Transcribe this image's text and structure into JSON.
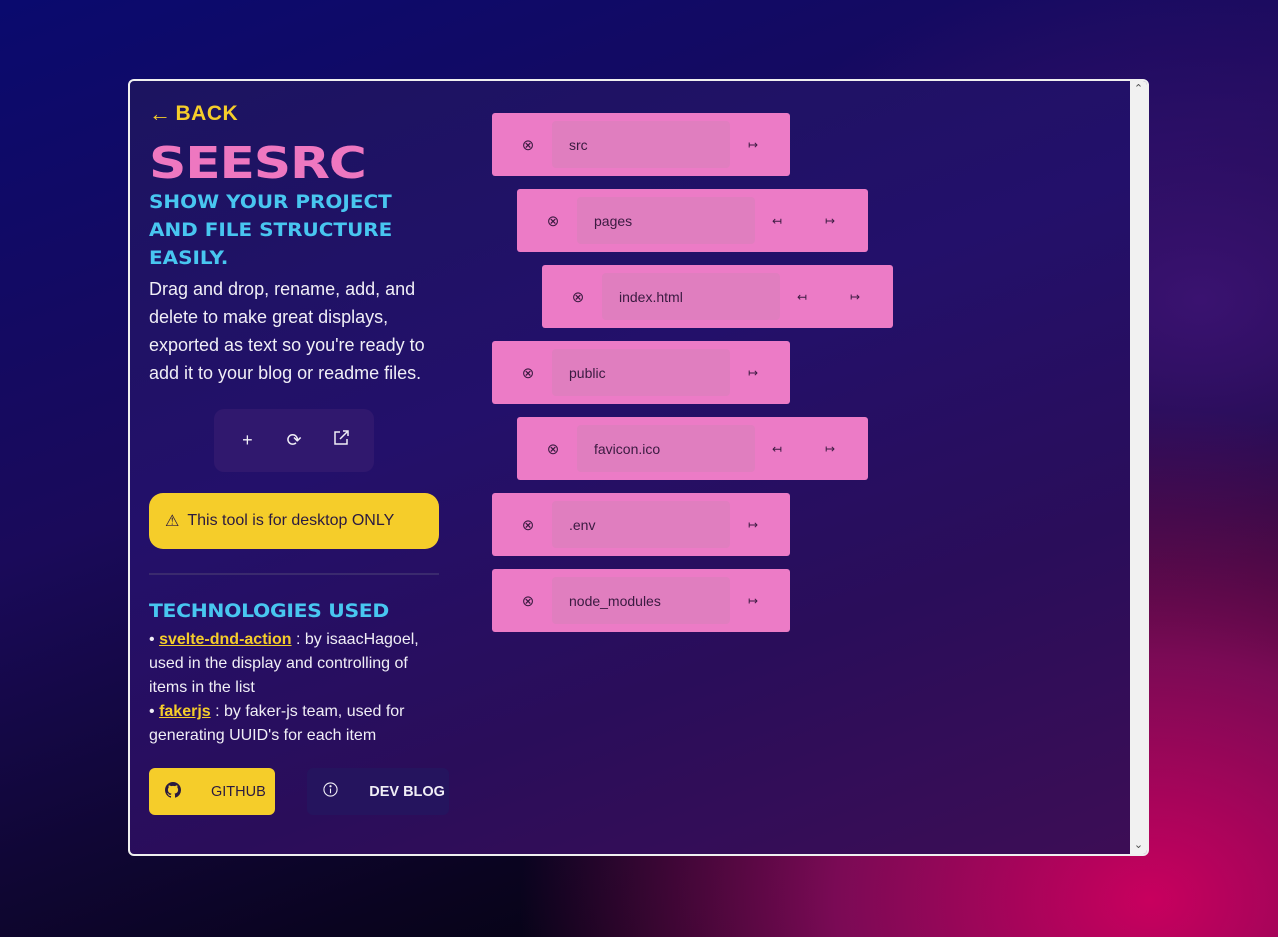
{
  "left": {
    "back_label": "BACK",
    "back_arrow": "←",
    "title": "SEESRC",
    "tagline": "SHOW YOUR PROJECT AND FILE STRUCTURE EASILY.",
    "description": "Drag and drop, rename, add, and delete to make  great displays, exported as text so you're ready to add it to your blog or readme files.",
    "toolbar": {
      "add_glyph": "+",
      "refresh_glyph": "⟳",
      "export_glyph": "⧉"
    },
    "warning": {
      "icon": "⚠",
      "text": "This tool is for desktop ONLY"
    },
    "tech_title": "TECHNOLOGIES USED",
    "tech": [
      {
        "bullet": "•",
        "name": "svelte-dnd-action",
        "text": " : by isaacHagoel, used in the display and controlling of items in the list"
      },
      {
        "bullet": "•",
        "name": "fakerjs",
        "text": " : by faker-js team, used for generating UUID's for each item"
      }
    ],
    "github_label": "GITHUB",
    "blog_label": "DEV BLOG"
  },
  "tree": [
    {
      "name": "src",
      "depth": 0,
      "outdent": false
    },
    {
      "name": "pages",
      "depth": 1,
      "outdent": true
    },
    {
      "name": "index.html",
      "depth": 2,
      "outdent": true
    },
    {
      "name": "public",
      "depth": 0,
      "outdent": false
    },
    {
      "name": "favicon.ico",
      "depth": 1,
      "outdent": true
    },
    {
      "name": ".env",
      "depth": 0,
      "outdent": false
    },
    {
      "name": "node_modules",
      "depth": 0,
      "outdent": false
    }
  ],
  "glyphs": {
    "remove": "⊗",
    "outdent": "↤",
    "indent": "↦"
  },
  "colors": {
    "accent_yellow": "#f5cd2a",
    "accent_pink": "#ee77c0",
    "accent_blue": "#48c6f0"
  }
}
